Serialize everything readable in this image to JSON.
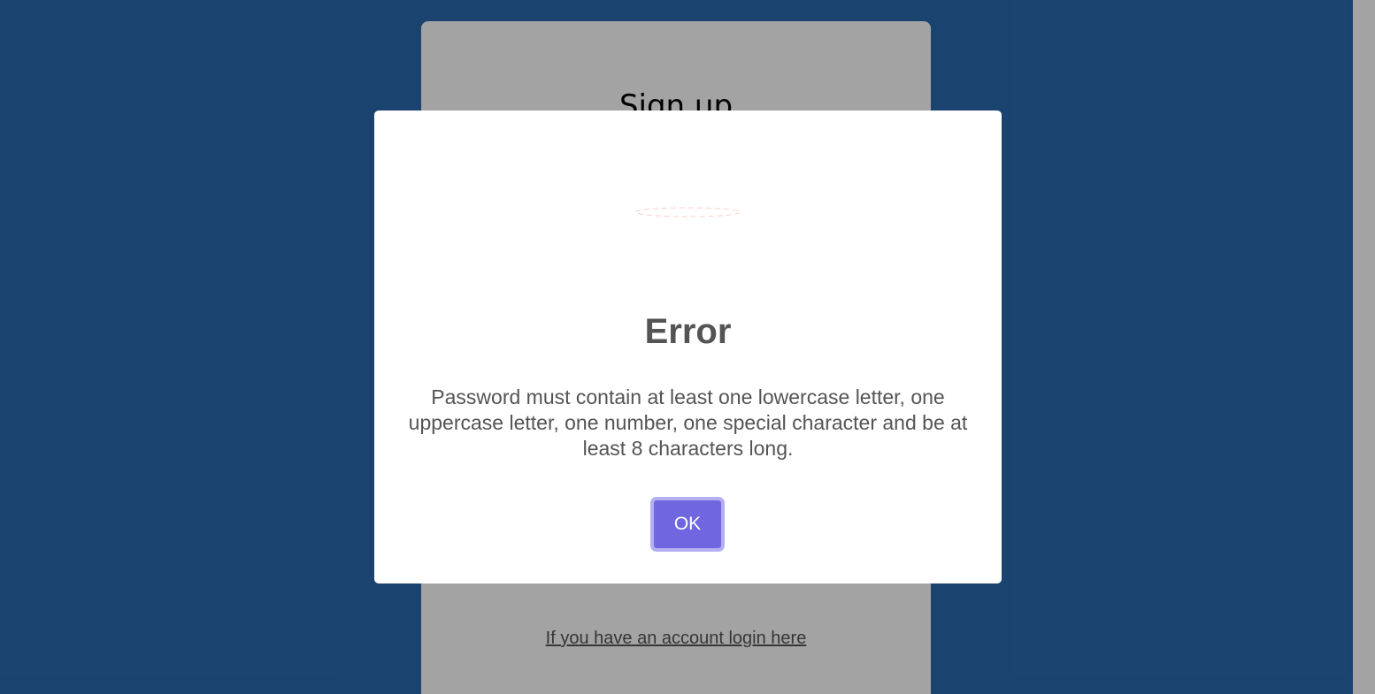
{
  "signup": {
    "title": "Sign up",
    "login_link": "If you have an account login here"
  },
  "dialog": {
    "icon": "error-icon",
    "title": "Error",
    "message": "Password must contain at least one lowercase letter, one uppercase letter, one number, one special character and be at least 8 characters long.",
    "confirm_label": "OK"
  },
  "colors": {
    "background": "#145592",
    "confirm_button": "#7066e0",
    "error_icon": "#f27474"
  }
}
